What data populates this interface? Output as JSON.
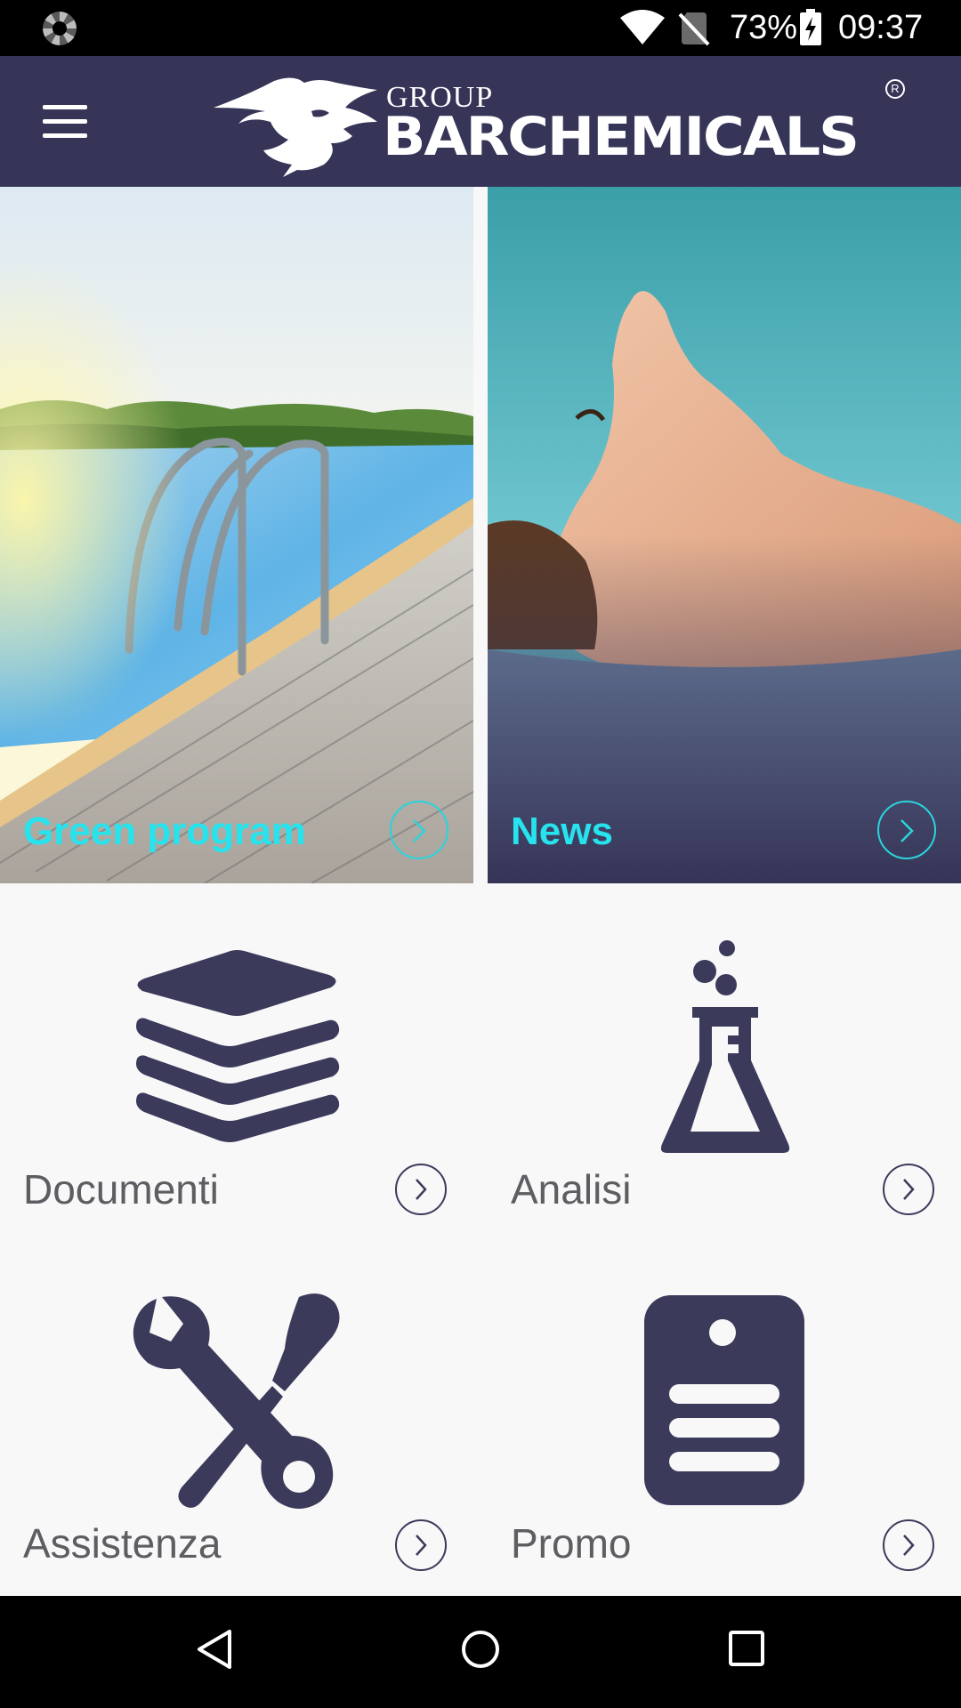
{
  "status_bar": {
    "battery_percent": "73%",
    "time": "09:37",
    "icons": [
      "loading-spinner-icon",
      "wifi-icon",
      "no-sim-icon",
      "battery-charging-icon"
    ]
  },
  "app_bar": {
    "menu_icon": "menu-icon",
    "logo_group": "GROUP",
    "logo_name": "BARCHEMICALS",
    "logo_registered": "R"
  },
  "tiles": [
    {
      "label": "Green program",
      "icon": "chevron-right-icon"
    },
    {
      "label": "News",
      "icon": "chevron-right-icon"
    }
  ],
  "menu_items": [
    {
      "label": "Documenti",
      "icon": "layers-stack-icon"
    },
    {
      "label": "Analisi",
      "icon": "flask-icon"
    },
    {
      "label": "Assistenza",
      "icon": "wrench-screwdriver-icon"
    },
    {
      "label": "Promo",
      "icon": "tag-list-icon"
    }
  ],
  "colors": {
    "primary": "#363457",
    "accent": "#26e3ee",
    "icon": "#3c3a5a",
    "label": "#5d5d62",
    "background": "#f8f8f9"
  },
  "nav_bar": {
    "buttons": [
      "back-icon",
      "home-icon",
      "recents-icon"
    ]
  }
}
